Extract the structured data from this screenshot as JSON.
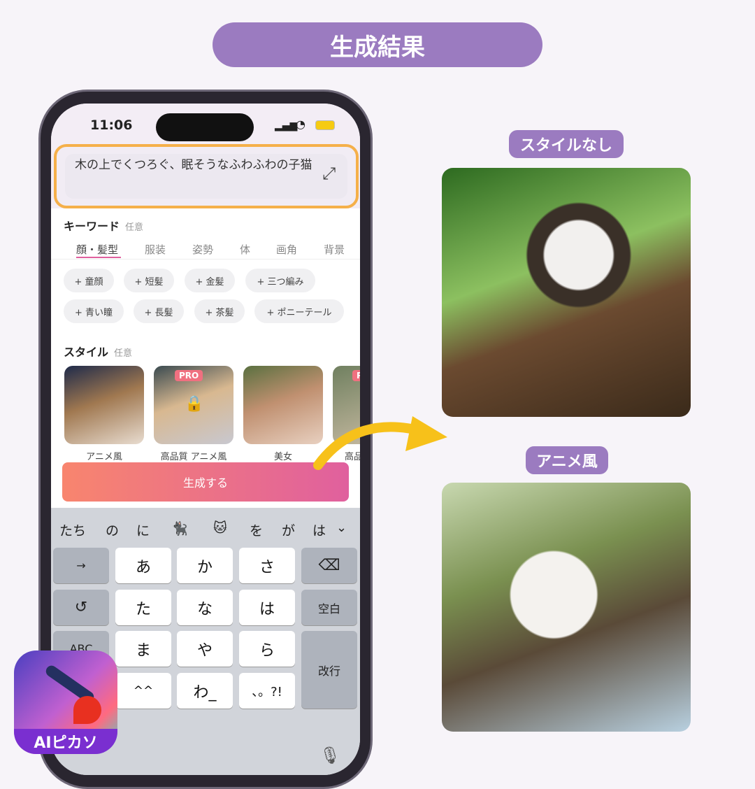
{
  "title": "生成結果",
  "status": {
    "time": "11:06"
  },
  "prompt": {
    "text": "木の上でくつろぐ、眠そうなふわふわの子猫"
  },
  "keyword": {
    "label": "キーワード",
    "optional": "任意",
    "tabs": [
      "顔・髪型",
      "服装",
      "姿勢",
      "体",
      "画角",
      "背景"
    ],
    "chips": [
      "+ 童顔",
      "+ 短髪",
      "+ 金髪",
      "+ 三つ編み",
      "+ 青い瞳",
      "+ 長髪",
      "+ 茶髪",
      "+ ポニーテール"
    ]
  },
  "style": {
    "label": "スタイル",
    "optional": "任意",
    "items": [
      {
        "name": "アニメ風"
      },
      {
        "name": "高品質 アニメ風",
        "badge": "PRO"
      },
      {
        "name": "美女"
      },
      {
        "name": "高品",
        "badge": "P"
      }
    ]
  },
  "generate_label": "生成する",
  "keyboard": {
    "suggestions": [
      "たち",
      "の",
      "に",
      "🐈‍⬛",
      "🐱",
      "を",
      "が",
      "は"
    ],
    "rows": [
      [
        "→",
        "あ",
        "か",
        "さ",
        "⌫"
      ],
      [
        "↺",
        "た",
        "な",
        "は",
        "空白"
      ],
      [
        "ABC",
        "ま",
        "や",
        "ら",
        "改行"
      ],
      [
        "",
        "^^",
        "わ_",
        "、。?!"
      ]
    ]
  },
  "results": [
    {
      "label": "スタイルなし"
    },
    {
      "label": "アニメ風"
    }
  ],
  "app": {
    "name": "AIピカソ"
  },
  "colors": {
    "accent": "#9b7bc0",
    "highlight": "#f5b04a",
    "arrow": "#f7c11a"
  }
}
